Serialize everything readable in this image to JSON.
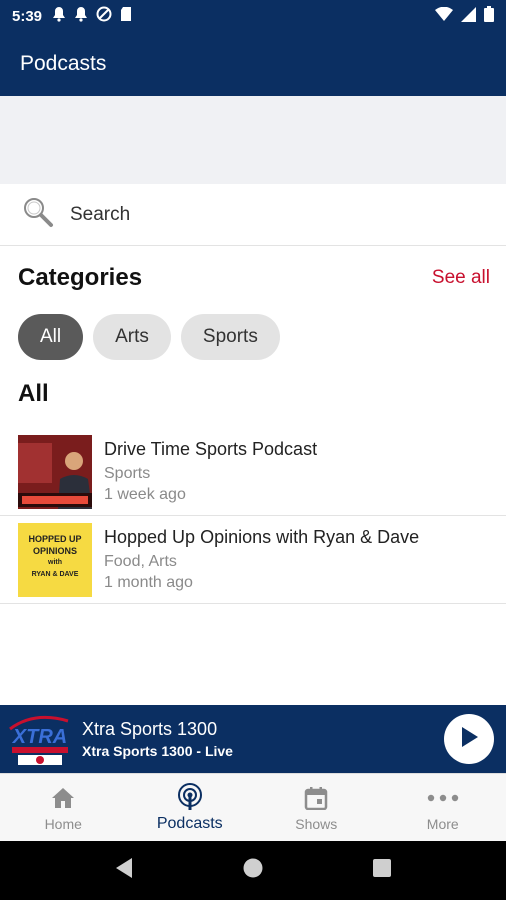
{
  "status_bar": {
    "time": "5:39",
    "icons": [
      "notification-bell-icon",
      "notification-bell-icon",
      "data-saver-icon",
      "sd-card-icon"
    ],
    "right_icons": [
      "wifi-icon",
      "signal-icon",
      "battery-icon"
    ]
  },
  "app_bar": {
    "title": "Podcasts"
  },
  "search": {
    "label": "Search",
    "icon": "search-icon"
  },
  "categories": {
    "title": "Categories",
    "see_all": "See all",
    "chips": [
      {
        "label": "All",
        "active": true
      },
      {
        "label": "Arts",
        "active": false
      },
      {
        "label": "Sports",
        "active": false
      }
    ]
  },
  "all_section": {
    "title": "All"
  },
  "podcasts": [
    {
      "title": "Drive Time Sports Podcast",
      "category": "Sports",
      "age": "1 week ago"
    },
    {
      "title": "Hopped Up Opinions with Ryan & Dave",
      "category": "Food, Arts",
      "age": "1 month ago",
      "thumb_text": [
        "HOPPED UP",
        "OPINIONS",
        "with",
        "RYAN & DAVE"
      ]
    }
  ],
  "player": {
    "station": "Xtra Sports 1300",
    "subtitle": "Xtra Sports 1300 - Live",
    "logo_text": "XTRA"
  },
  "bottom_nav": [
    {
      "label": "Home",
      "icon": "home-icon",
      "active": false
    },
    {
      "label": "Podcasts",
      "icon": "podcast-icon",
      "active": true
    },
    {
      "label": "Shows",
      "icon": "calendar-icon",
      "active": false
    },
    {
      "label": "More",
      "icon": "more-dots-icon",
      "active": false
    }
  ],
  "colors": {
    "brand": "#0b2f62",
    "accent": "#c8102e",
    "chip_active": "#5a5a5a",
    "chip": "#e3e3e3"
  }
}
